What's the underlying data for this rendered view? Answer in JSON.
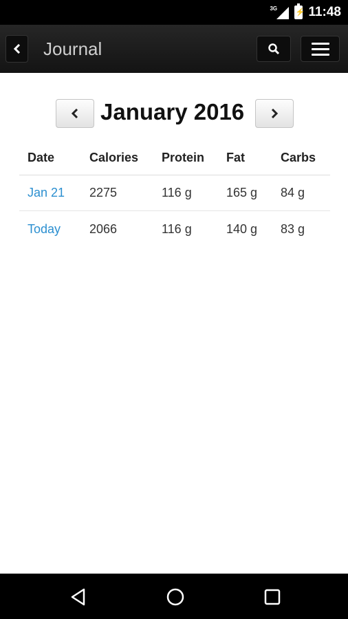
{
  "status_bar": {
    "network_label": "3G",
    "time": "11:48"
  },
  "app_bar": {
    "back_icon": "chevron-left",
    "title": "Journal",
    "search_icon": "search",
    "menu_icon": "hamburger-menu"
  },
  "month_nav": {
    "prev_icon": "chevron-left",
    "month_title": "January 2016",
    "next_icon": "chevron-right"
  },
  "table": {
    "headers": [
      "Date",
      "Calories",
      "Protein",
      "Fat",
      "Carbs"
    ],
    "rows": [
      {
        "date": "Jan 21",
        "calories": "2275",
        "protein": "116 g",
        "fat": "165 g",
        "carbs": "84 g"
      },
      {
        "date": "Today",
        "calories": "2066",
        "protein": "116 g",
        "fat": "140 g",
        "carbs": "83 g"
      }
    ]
  },
  "colors": {
    "link": "#2b8fd0",
    "app_bar": "#1c1c1c",
    "status_bar": "#000000"
  },
  "nav_bar": {
    "back_icon": "triangle-back",
    "home_icon": "circle-home",
    "recents_icon": "square-recents"
  }
}
